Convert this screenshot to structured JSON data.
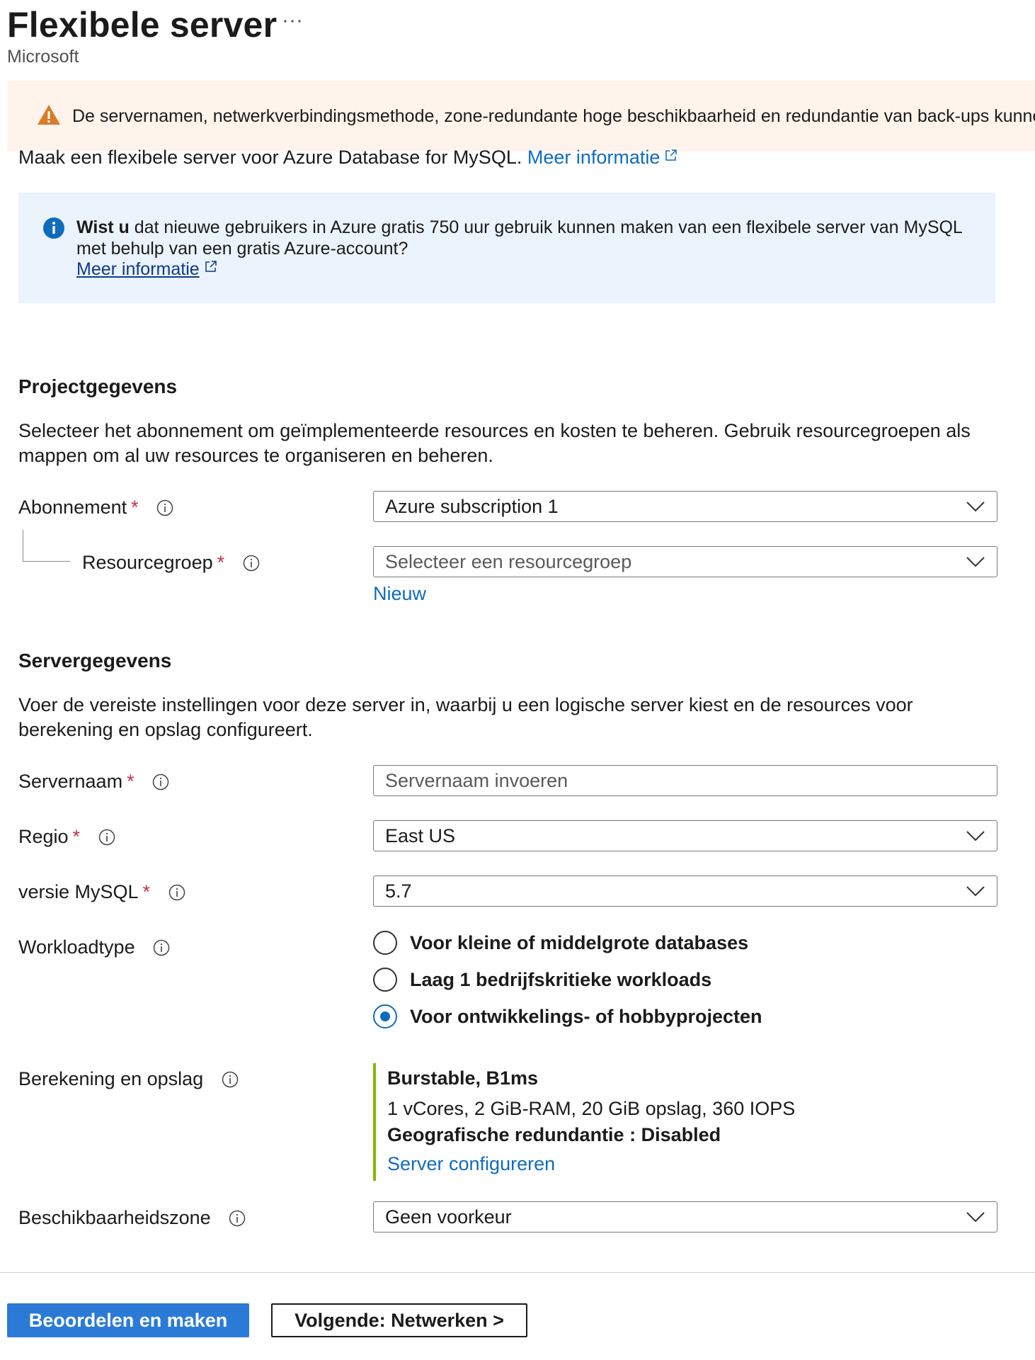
{
  "header": {
    "title": "Flexibele server",
    "more": "···",
    "publisher": "Microsoft"
  },
  "warning": {
    "text": "De servernamen, netwerkverbindingsmethode, zone-redundante hoge beschikbaarheid en redundantie van back-ups kunnen niet"
  },
  "intro": {
    "text": "Maak een flexibele server voor Azure Database for MySQL.",
    "link": "Meer informatie"
  },
  "info": {
    "bold": "Wist u",
    "text": "dat nieuwe gebruikers in Azure gratis 750 uur gebruik kunnen maken van een flexibele server van MySQL met behulp van een gratis Azure-account?",
    "link": "Meer informatie"
  },
  "project": {
    "heading": "Projectgegevens",
    "description": "Selecteer het abonnement om geïmplementeerde resources en kosten te beheren. Gebruik resourcegroepen als mappen om al uw resources te organiseren en beheren.",
    "subscription_label": "Abonnement",
    "subscription_value": "Azure subscription 1",
    "rg_label": "Resourcegroep",
    "rg_placeholder": "Selecteer een resourcegroep",
    "rg_new": "Nieuw"
  },
  "server": {
    "heading": "Servergegevens",
    "description": "Voer de vereiste instellingen voor deze server in, waarbij u een logische server kiest en de resources voor berekening en opslag configureert.",
    "name_label": "Servernaam",
    "name_placeholder": "Servernaam invoeren",
    "region_label": "Regio",
    "region_value": "East US",
    "version_label": "versie MySQL",
    "version_value": "5.7",
    "workload_label": "Workloadtype",
    "workload_options": [
      {
        "label": "Voor kleine of middelgrote databases",
        "selected": false
      },
      {
        "label": "Laag 1 bedrijfskritieke workloads",
        "selected": false
      },
      {
        "label": "Voor ontwikkelings- of hobbyprojecten",
        "selected": true
      }
    ],
    "compute_label": "Berekening en opslag",
    "compute_tier": "Burstable, B1ms",
    "compute_spec": "1 vCores, 2 GiB-RAM, 20 GiB opslag, 360 IOPS",
    "compute_geo": "Geografische redundantie : Disabled",
    "compute_link": "Server configureren",
    "az_label": "Beschikbaarheidszone",
    "az_value": "Geen voorkeur"
  },
  "required_mark": "*",
  "footer": {
    "review_create": "Beoordelen en maken",
    "next": "Volgende: Netwerken >"
  },
  "colors": {
    "link": "#0f6cbd",
    "primary_button": "#2b7bd6",
    "warning_bg": "#fff4ec",
    "info_bg": "#ebf3fc",
    "required": "#c4314b",
    "compute_accent": "#7fba00"
  },
  "icons": {
    "warning": "warning-triangle-icon",
    "info": "info-circle-icon",
    "external": "external-link-icon",
    "tooltip": "info-tooltip-icon",
    "dropdown": "chevron-down-icon"
  }
}
